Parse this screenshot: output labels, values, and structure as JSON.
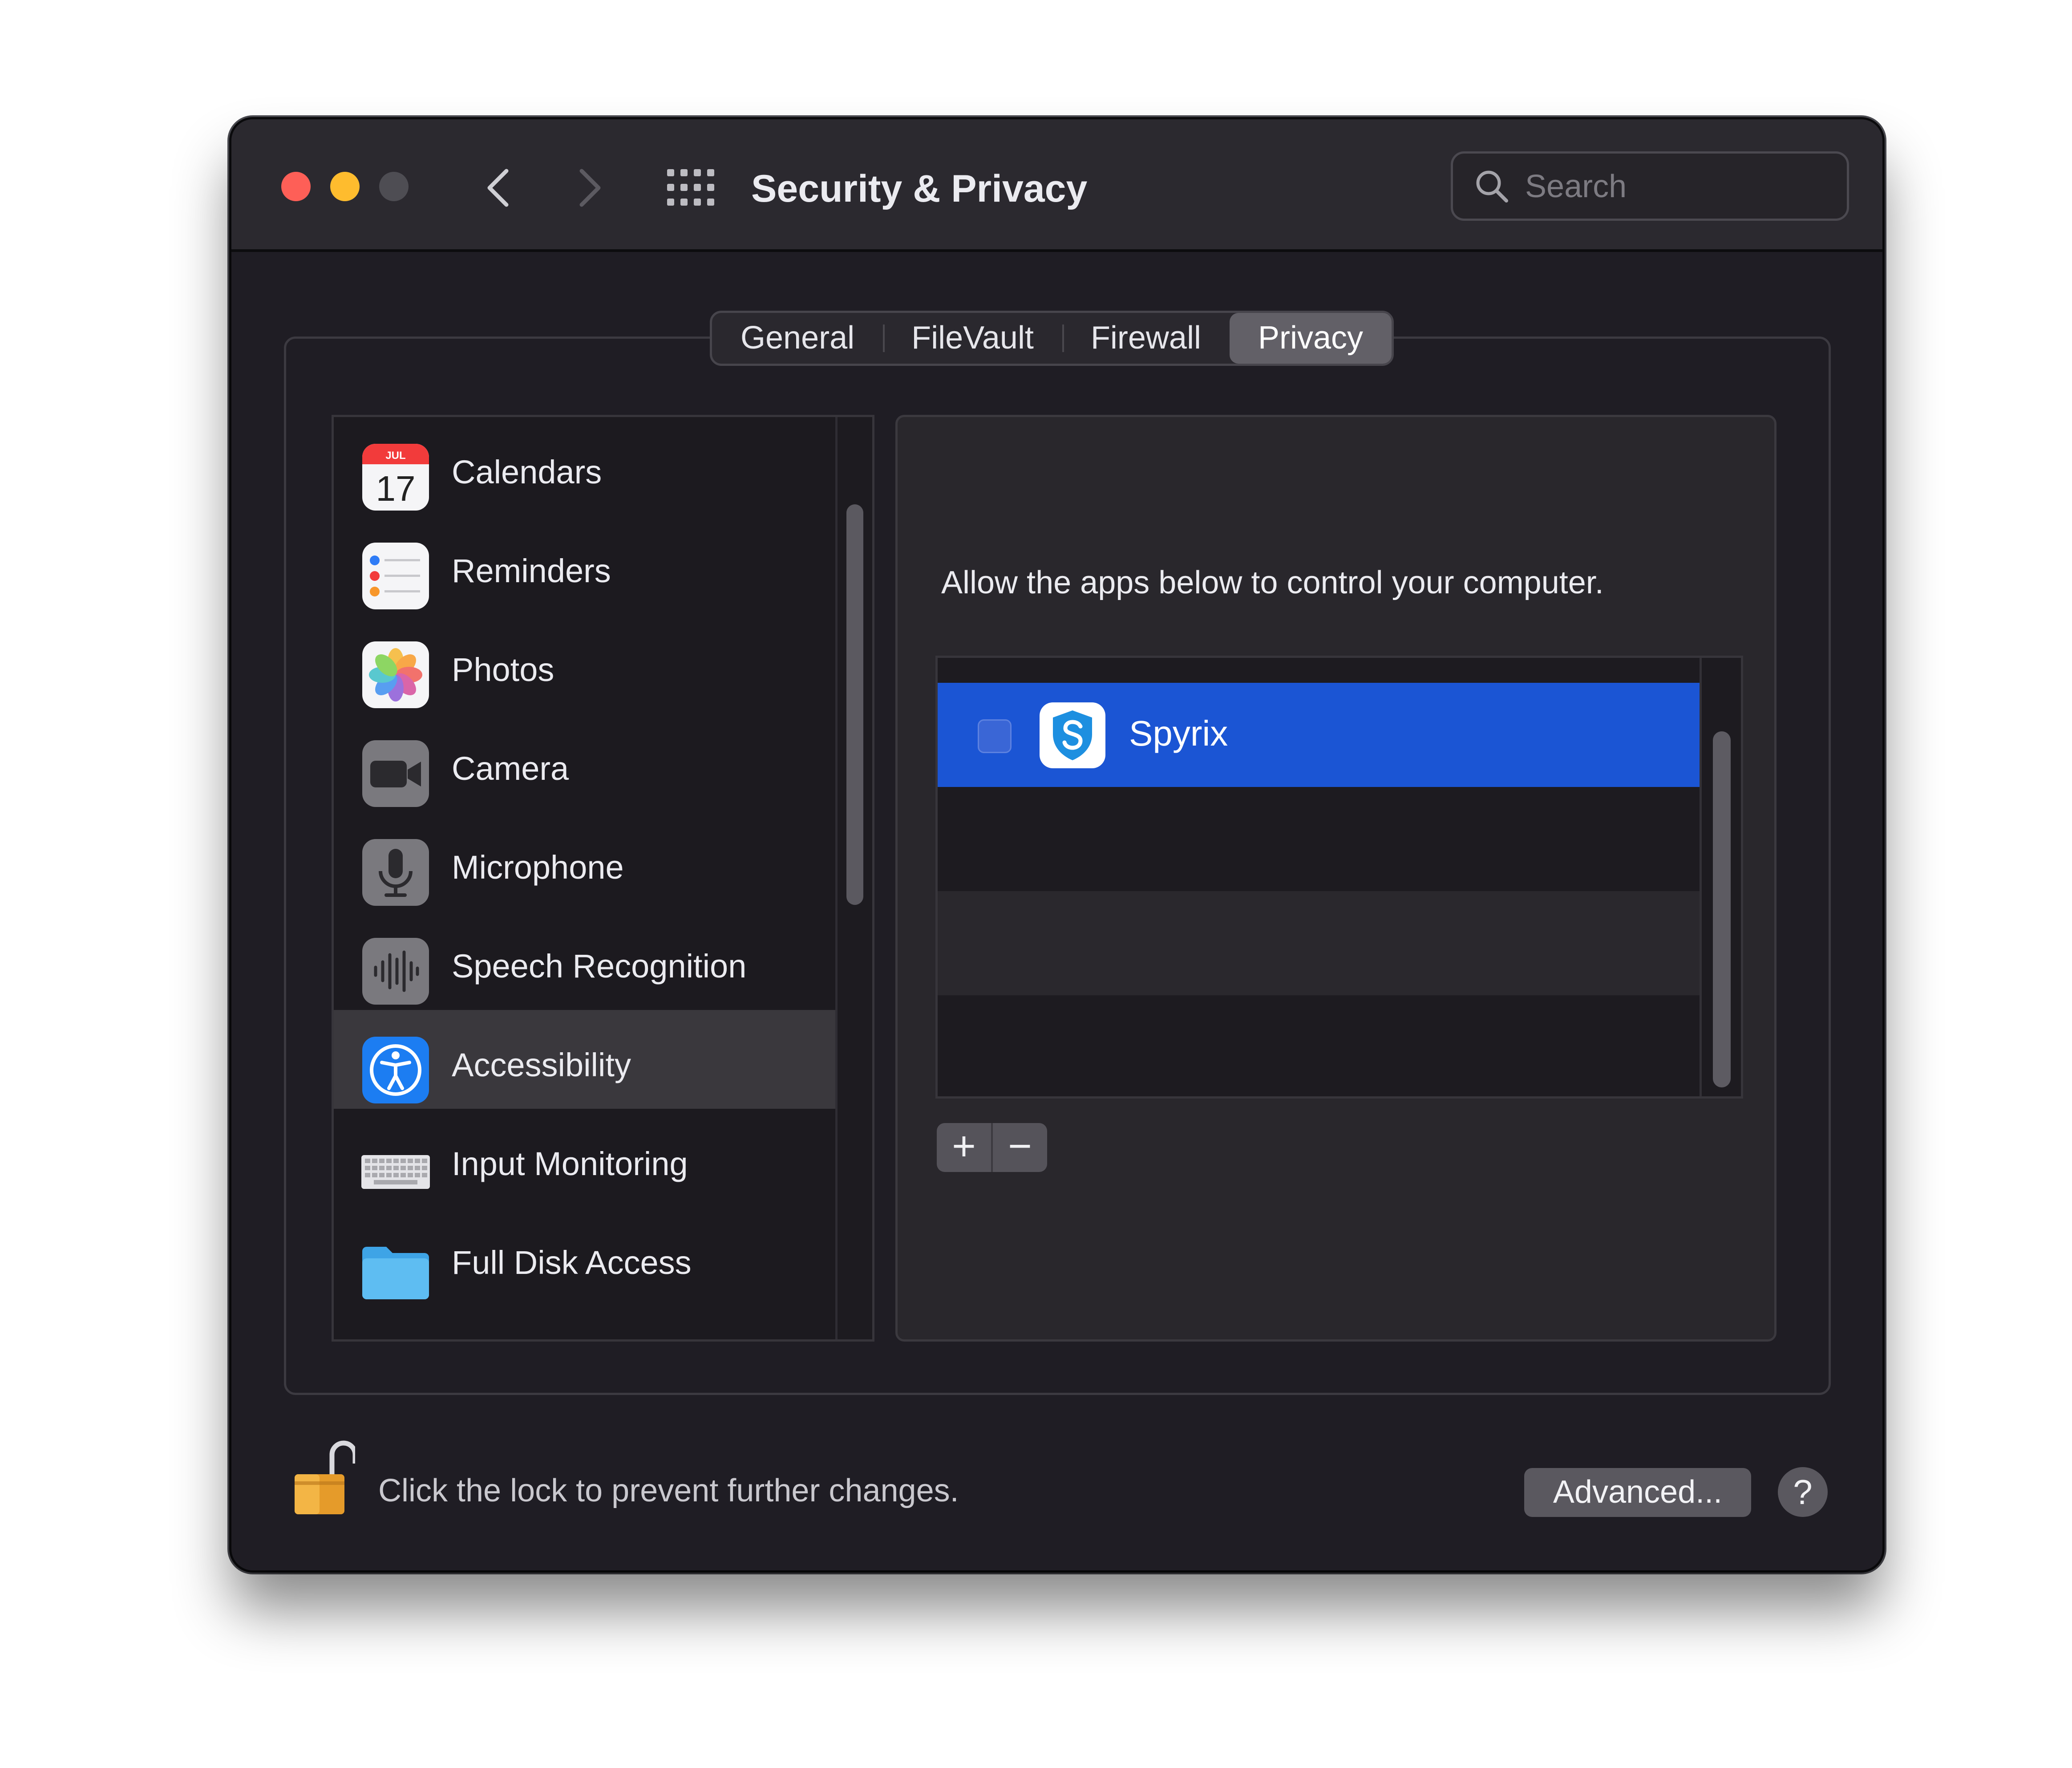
{
  "window": {
    "title": "Security & Privacy"
  },
  "search": {
    "placeholder": "Search"
  },
  "tabs": [
    {
      "label": "General"
    },
    {
      "label": "FileVault"
    },
    {
      "label": "Firewall"
    },
    {
      "label": "Privacy",
      "selected": true
    }
  ],
  "sidebar": {
    "items": [
      {
        "label": "Calendars",
        "icon": "calendar-icon",
        "calendar_month": "JUL",
        "calendar_day": "17"
      },
      {
        "label": "Reminders",
        "icon": "reminders-icon"
      },
      {
        "label": "Photos",
        "icon": "photos-icon"
      },
      {
        "label": "Camera",
        "icon": "camera-icon"
      },
      {
        "label": "Microphone",
        "icon": "microphone-icon"
      },
      {
        "label": "Speech Recognition",
        "icon": "speech-recognition-icon"
      },
      {
        "label": "Accessibility",
        "icon": "accessibility-icon",
        "selected": true
      },
      {
        "label": "Input Monitoring",
        "icon": "keyboard-icon"
      },
      {
        "label": "Full Disk Access",
        "icon": "folder-icon"
      }
    ]
  },
  "detail": {
    "description": "Allow the apps below to control your computer.",
    "apps": [
      {
        "name": "Spyrix",
        "checked": false,
        "selected": true,
        "icon": "spyrix-shield-icon"
      }
    ],
    "add_label": "+",
    "remove_label": "−"
  },
  "footer": {
    "lock_text": "Click the lock to prevent further changes.",
    "advanced_label": "Advanced...",
    "help_label": "?"
  },
  "colors": {
    "window_bg": "#1f1d24",
    "selection_blue": "#1b55d4",
    "close": "#fe5f57",
    "minimize": "#febc2e"
  }
}
